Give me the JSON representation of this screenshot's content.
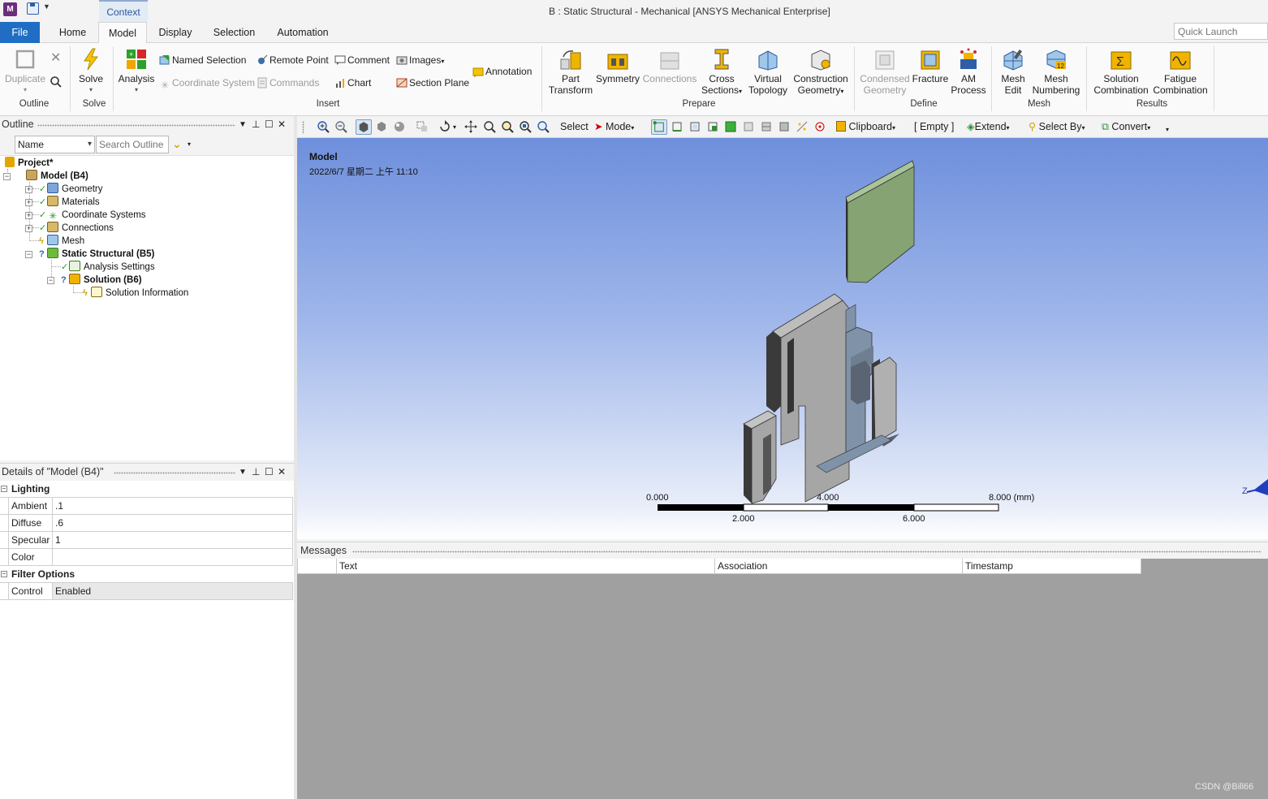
{
  "titlebar": {
    "app_icon": "M",
    "context_tab": "Context",
    "window_title": "B : Static Structural - Mechanical [ANSYS Mechanical Enterprise]"
  },
  "tabs": {
    "file": "File",
    "home": "Home",
    "model": "Model",
    "display": "Display",
    "selection": "Selection",
    "automation": "Automation"
  },
  "quick_launch": {
    "placeholder": "Quick Launch"
  },
  "ribbon": {
    "duplicate": "Duplicate",
    "solve": "Solve",
    "analysis": "Analysis",
    "named_selection": "Named Selection",
    "coordinate_system": "Coordinate System",
    "remote_point": "Remote Point",
    "commands": "Commands",
    "comment": "Comment",
    "chart": "Chart",
    "images": "Images",
    "section_plane": "Section Plane",
    "annotation": "Annotation",
    "part_transform_1": "Part",
    "part_transform_2": "Transform",
    "symmetry": "Symmetry",
    "connections": "Connections",
    "cross_sections_1": "Cross",
    "cross_sections_2": "Sections",
    "virtual_topology_1": "Virtual",
    "virtual_topology_2": "Topology",
    "construction_geometry_1": "Construction",
    "construction_geometry_2": "Geometry",
    "condensed_geometry_1": "Condensed",
    "condensed_geometry_2": "Geometry",
    "fracture": "Fracture",
    "am_process_1": "AM",
    "am_process_2": "Process",
    "mesh_edit_1": "Mesh",
    "mesh_edit_2": "Edit",
    "mesh_numbering_1": "Mesh",
    "mesh_numbering_2": "Numbering",
    "solution_combination_1": "Solution",
    "solution_combination_2": "Combination",
    "fatigue_combination_1": "Fatigue",
    "fatigue_combination_2": "Combination",
    "groups": {
      "outline": "Outline",
      "solve": "Solve",
      "insert": "Insert",
      "prepare": "Prepare",
      "define": "Define",
      "mesh": "Mesh",
      "results": "Results"
    }
  },
  "outline": {
    "title": "Outline",
    "name_filter": "Name",
    "search_placeholder": "Search Outline",
    "tree": {
      "project": "Project*",
      "model": "Model (B4)",
      "geometry": "Geometry",
      "materials": "Materials",
      "coordinate_systems": "Coordinate Systems",
      "connections": "Connections",
      "mesh": "Mesh",
      "static_structural": "Static Structural (B5)",
      "analysis_settings": "Analysis Settings",
      "solution": "Solution (B6)",
      "solution_information": "Solution Information"
    }
  },
  "details": {
    "title": "Details of \"Model (B4)\"",
    "lighting": "Lighting",
    "rows": [
      {
        "label": "Ambient",
        "value": ".1"
      },
      {
        "label": "Diffuse",
        "value": ".6"
      },
      {
        "label": "Specular",
        "value": "1"
      },
      {
        "label": "Color",
        "value": ""
      }
    ],
    "filter_options": "Filter Options",
    "control_label": "Control",
    "control_value": "Enabled"
  },
  "graphics_toolbar": {
    "select": "Select",
    "mode": "Mode",
    "clipboard": "Clipboard",
    "empty": "[ Empty ]",
    "extend": "Extend",
    "select_by": "Select By",
    "convert": "Convert"
  },
  "viewport": {
    "model_label": "Model",
    "timestamp": "2022/6/7 星期二 上午 11:10",
    "scale_top": [
      "0.000",
      "4.000",
      "8.000 (mm)"
    ],
    "scale_bottom": [
      "2.000",
      "6.000"
    ],
    "triad_label": "Z"
  },
  "messages": {
    "title": "Messages",
    "columns": [
      "Text",
      "Association",
      "Timestamp"
    ]
  },
  "watermark": "CSDN @Bill66",
  "colors": {
    "file_tab": "#1f6ec4",
    "viewport_top": "#6e8fdc",
    "viewport_bottom": "#ffffff",
    "body_green": "#86a373",
    "body_gray": "#a6a6a6",
    "body_bluegray": "#7f92a8",
    "check_green": "#22a022"
  }
}
